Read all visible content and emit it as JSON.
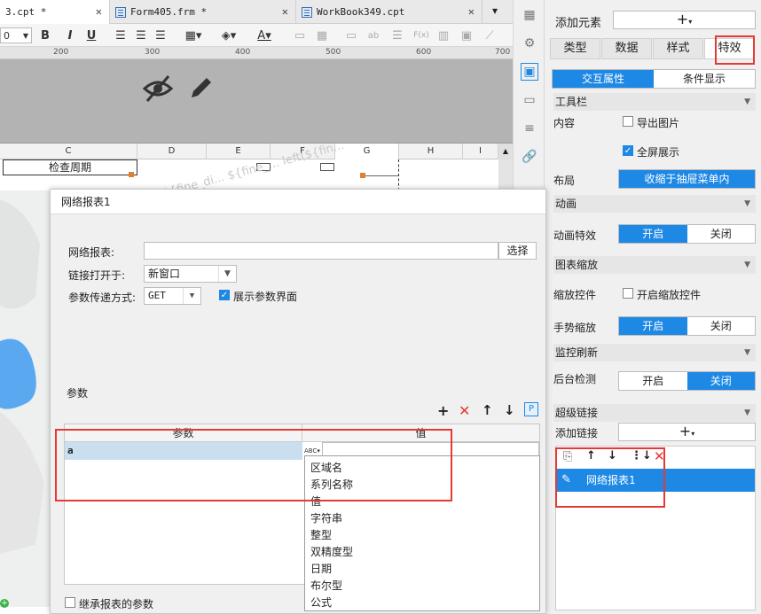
{
  "tabs": [
    {
      "label": "3.cpt *",
      "active": true
    },
    {
      "label": "Form405.frm *",
      "active": false
    },
    {
      "label": "WorkBook349.cpt",
      "active": false
    }
  ],
  "toolbar": {
    "font_size": "0",
    "bold": "B",
    "italic": "I",
    "underline": "U",
    "text_color_icon": "A",
    "formula_icon": "F(x)",
    "ab_icon": "ab"
  },
  "ruler": {
    "marks": [
      "200",
      "300",
      "400",
      "500",
      "600",
      "700"
    ]
  },
  "columns": [
    "C",
    "D",
    "E",
    "F",
    "G",
    "H",
    "I"
  ],
  "sheet": {
    "check_cycle": "检查周期",
    "watermark": "${fine_di... ${fine_... left(${fin..."
  },
  "panel": {
    "add_element_label": "添加元素",
    "add_symbol": "+",
    "tabs": [
      "类型",
      "数据",
      "样式",
      "特效"
    ],
    "subtabs": [
      "交互属性",
      "条件显示"
    ],
    "toolbar_section": "工具栏",
    "content_label": "内容",
    "export_image": "导出图片",
    "fullscreen": "全屏展示",
    "layout_label": "布局",
    "layout_value": "收缩于抽屉菜单内",
    "animation_section": "动画",
    "animation_effect": "动画特效",
    "on": "开启",
    "off": "关闭",
    "chart_zoom_section": "图表缩放",
    "zoom_control": "缩放控件",
    "enable_zoom": "开启缩放控件",
    "gesture_zoom": "手势缩放",
    "monitor_section": "监控刷新",
    "bg_detect": "后台检测",
    "hyperlink_section": "超级链接",
    "add_link": "添加链接",
    "link_item": "网络报表1"
  },
  "dialog": {
    "title": "网络报表1",
    "report_label": "网络报表:",
    "select_button": "选择",
    "open_in_label": "链接打开于:",
    "open_in_value": "新窗口",
    "param_method_label": "参数传递方式:",
    "param_method_value": "GET",
    "show_param_ui": "展示参数界面",
    "params_section": "参数",
    "col_param": "参数",
    "col_value": "值",
    "row_param": "a",
    "type_icon_text": "ABC",
    "p_icon": "P",
    "inherit_params": "继承报表的参数",
    "type_options": [
      "区域名",
      "系列名称",
      "值",
      "字符串",
      "整型",
      "双精度型",
      "日期",
      "布尔型",
      "公式"
    ]
  },
  "colors": {
    "accent": "#1e88e5",
    "highlight": "#e53935"
  }
}
